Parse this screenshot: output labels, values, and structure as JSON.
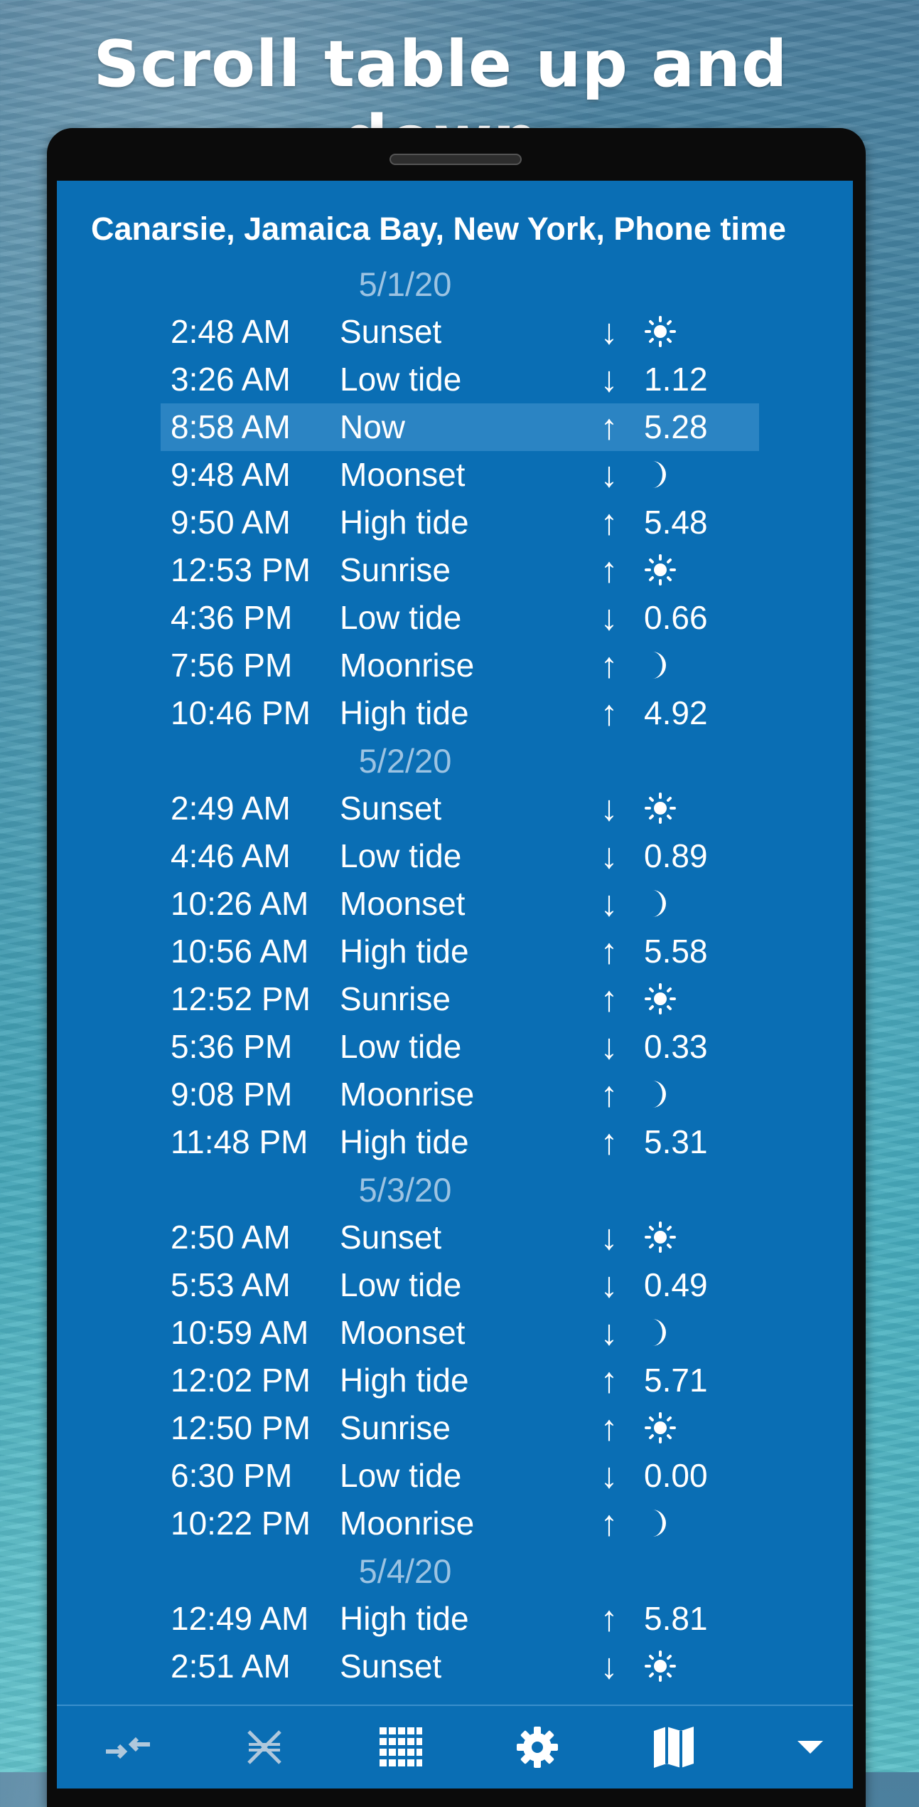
{
  "headline": "Scroll table up and down",
  "location": "Canarsie, Jamaica Bay, New York, Phone time",
  "days": [
    {
      "date": "5/1/20",
      "events": [
        {
          "time": "2:48 AM",
          "event": "Sunset",
          "dir": "↓",
          "value": "",
          "icon": "sun-icon"
        },
        {
          "time": "3:26 AM",
          "event": "Low tide",
          "dir": "↓",
          "value": "1.12",
          "icon": ""
        },
        {
          "time": "8:58 AM",
          "event": "Now",
          "dir": "↑",
          "value": "5.28",
          "icon": "",
          "highlight": true
        },
        {
          "time": "9:48 AM",
          "event": "Moonset",
          "dir": "↓",
          "value": "",
          "icon": "moon-icon"
        },
        {
          "time": "9:50 AM",
          "event": "High tide",
          "dir": "↑",
          "value": "5.48",
          "icon": ""
        },
        {
          "time": "12:53 PM",
          "event": "Sunrise",
          "dir": "↑",
          "value": "",
          "icon": "sun-icon"
        },
        {
          "time": "4:36 PM",
          "event": "Low tide",
          "dir": "↓",
          "value": "0.66",
          "icon": ""
        },
        {
          "time": "7:56 PM",
          "event": "Moonrise",
          "dir": "↑",
          "value": "",
          "icon": "moon-icon"
        },
        {
          "time": "10:46 PM",
          "event": "High tide",
          "dir": "↑",
          "value": "4.92",
          "icon": ""
        }
      ]
    },
    {
      "date": "5/2/20",
      "events": [
        {
          "time": "2:49 AM",
          "event": "Sunset",
          "dir": "↓",
          "value": "",
          "icon": "sun-icon"
        },
        {
          "time": "4:46 AM",
          "event": "Low tide",
          "dir": "↓",
          "value": "0.89",
          "icon": ""
        },
        {
          "time": "10:26 AM",
          "event": "Moonset",
          "dir": "↓",
          "value": "",
          "icon": "moon-icon"
        },
        {
          "time": "10:56 AM",
          "event": "High tide",
          "dir": "↑",
          "value": "5.58",
          "icon": ""
        },
        {
          "time": "12:52 PM",
          "event": "Sunrise",
          "dir": "↑",
          "value": "",
          "icon": "sun-icon"
        },
        {
          "time": "5:36 PM",
          "event": "Low tide",
          "dir": "↓",
          "value": "0.33",
          "icon": ""
        },
        {
          "time": "9:08 PM",
          "event": "Moonrise",
          "dir": "↑",
          "value": "",
          "icon": "moon-icon"
        },
        {
          "time": "11:48 PM",
          "event": "High tide",
          "dir": "↑",
          "value": "5.31",
          "icon": ""
        }
      ]
    },
    {
      "date": "5/3/20",
      "events": [
        {
          "time": "2:50 AM",
          "event": "Sunset",
          "dir": "↓",
          "value": "",
          "icon": "sun-icon"
        },
        {
          "time": "5:53 AM",
          "event": "Low tide",
          "dir": "↓",
          "value": "0.49",
          "icon": ""
        },
        {
          "time": "10:59 AM",
          "event": "Moonset",
          "dir": "↓",
          "value": "",
          "icon": "moon-icon"
        },
        {
          "time": "12:02 PM",
          "event": "High tide",
          "dir": "↑",
          "value": "5.71",
          "icon": ""
        },
        {
          "time": "12:50 PM",
          "event": "Sunrise",
          "dir": "↑",
          "value": "",
          "icon": "sun-icon"
        },
        {
          "time": "6:30 PM",
          "event": "Low tide",
          "dir": "↓",
          "value": "0.00",
          "icon": ""
        },
        {
          "time": "10:22 PM",
          "event": "Moonrise",
          "dir": "↑",
          "value": "",
          "icon": "moon-icon"
        }
      ]
    },
    {
      "date": "5/4/20",
      "events": [
        {
          "time": "12:49 AM",
          "event": "High tide",
          "dir": "↑",
          "value": "5.81",
          "icon": ""
        },
        {
          "time": "2:51 AM",
          "event": "Sunset",
          "dir": "↓",
          "value": "",
          "icon": "sun-icon"
        }
      ]
    }
  ],
  "bottom_nav": [
    {
      "name": "compress-icon"
    },
    {
      "name": "tide-marker-icon"
    },
    {
      "name": "grid-icon"
    },
    {
      "name": "gear-icon"
    },
    {
      "name": "map-icon"
    },
    {
      "name": "dropdown-icon"
    }
  ],
  "colors": {
    "screen_bg": "#0a6eb4",
    "highlight_row": "#2b84c3",
    "date_text": "#9cc3e2",
    "nav_icon": "#ffffff",
    "nav_icon_muted": "#b0c8dc"
  }
}
